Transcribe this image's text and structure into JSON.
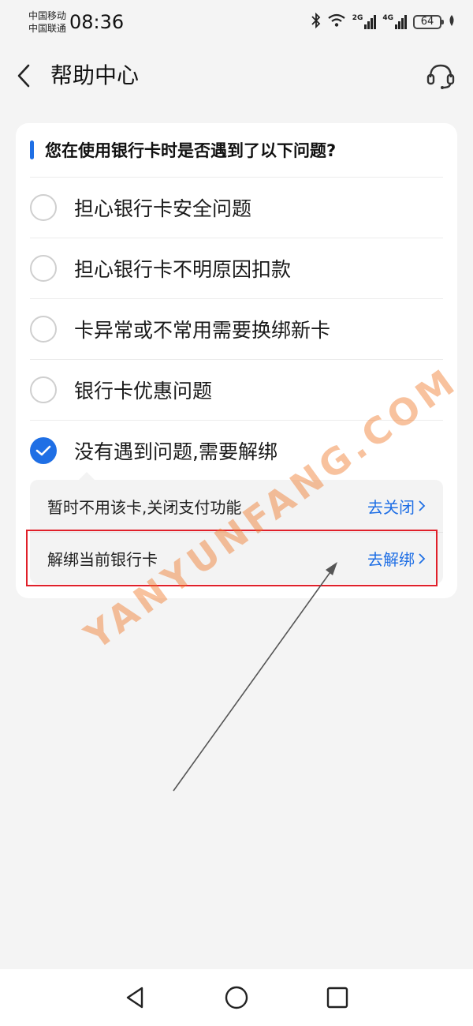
{
  "status_bar": {
    "carrier_1": "中国移动",
    "carrier_2": "中国联通",
    "time": "08:36",
    "net_1": "2G",
    "net_2": "4G",
    "battery": "64"
  },
  "header": {
    "title": "帮助中心",
    "back_icon": "chevron-left-icon",
    "service_icon": "headset-icon"
  },
  "card": {
    "question": "您在使用银行卡时是否遇到了以下问题?",
    "options": [
      {
        "label": "担心银行卡安全问题",
        "checked": false
      },
      {
        "label": "担心银行卡不明原因扣款",
        "checked": false
      },
      {
        "label": "卡异常或不常用需要换绑新卡",
        "checked": false
      },
      {
        "label": "银行卡优惠问题",
        "checked": false
      },
      {
        "label": "没有遇到问题,需要解绑",
        "checked": true
      }
    ],
    "sub_options": [
      {
        "label": "暂时不用该卡,关闭支付功能",
        "action": "去关闭"
      },
      {
        "label": "解绑当前银行卡",
        "action": "去解绑"
      }
    ]
  },
  "watermark": "YANYUNFANG.COM",
  "colors": {
    "accent": "#1f6fe5",
    "highlight": "#e0202a",
    "background": "#f4f4f4"
  }
}
